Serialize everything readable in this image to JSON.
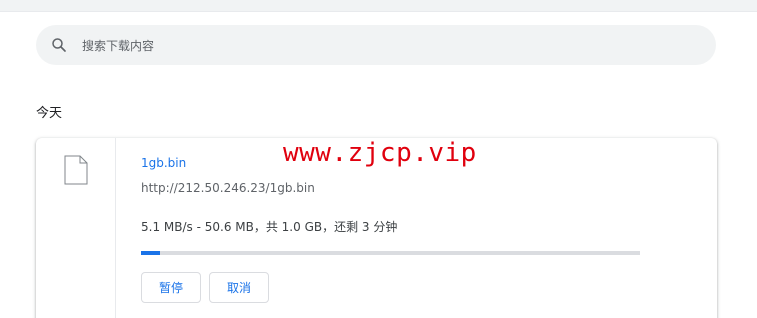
{
  "search": {
    "placeholder": "搜索下载内容",
    "icon": "search-icon"
  },
  "section": {
    "title": "今天"
  },
  "download": {
    "file_name": "1gb.bin",
    "url": "http://212.50.246.23/1gb.bin",
    "status": "5.1 MB/s - 50.6 MB，共 1.0 GB，还剩 3 分钟",
    "progress_fraction": 0.038,
    "pause_label": "暂停",
    "cancel_label": "取消"
  },
  "watermark": {
    "text": "www.zjcp.vip"
  },
  "colors": {
    "accent": "#1a73e8",
    "watermark": "#e0000e",
    "search_bg": "#f1f3f4"
  }
}
